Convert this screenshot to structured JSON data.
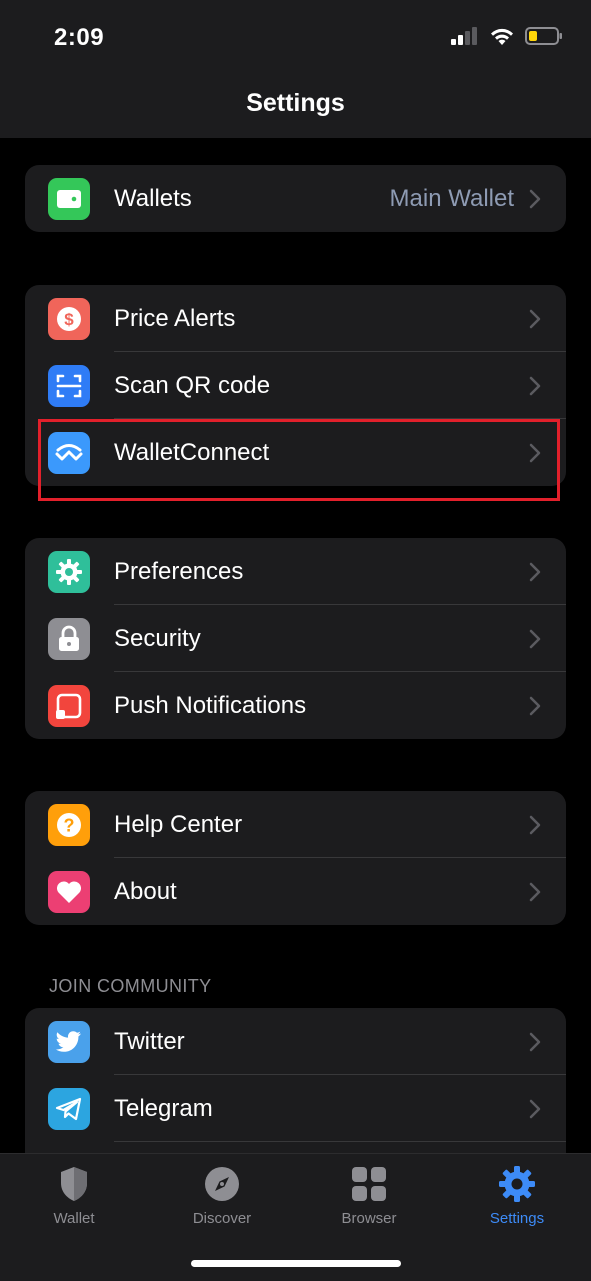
{
  "status_bar": {
    "time": "2:09"
  },
  "header": {
    "title": "Settings"
  },
  "groups": {
    "wallets": {
      "items": [
        {
          "label": "Wallets",
          "value": "Main Wallet",
          "icon": "wallet-icon",
          "color": "#34c759"
        }
      ]
    },
    "tools": {
      "items": [
        {
          "label": "Price Alerts",
          "icon": "dollar-icon",
          "color": "#f0655a"
        },
        {
          "label": "Scan QR code",
          "icon": "scan-qr-icon",
          "color": "#2f7cf6"
        },
        {
          "label": "WalletConnect",
          "icon": "walletconnect-icon",
          "color": "#3b99fc"
        }
      ]
    },
    "settings": {
      "items": [
        {
          "label": "Preferences",
          "icon": "gear-icon",
          "color": "#2fbf9a"
        },
        {
          "label": "Security",
          "icon": "lock-icon",
          "color": "#8e8e93"
        },
        {
          "label": "Push Notifications",
          "icon": "notification-icon",
          "color": "#f2453d"
        }
      ]
    },
    "support": {
      "items": [
        {
          "label": "Help Center",
          "icon": "question-icon",
          "color": "#ff9f0a"
        },
        {
          "label": "About",
          "icon": "heart-icon",
          "color": "#ec3f73"
        }
      ]
    },
    "community": {
      "header": "JOIN COMMUNITY",
      "items": [
        {
          "label": "Twitter",
          "icon": "twitter-icon",
          "color": "#4aa1eb"
        },
        {
          "label": "Telegram",
          "icon": "telegram-icon",
          "color": "#2ca5e0"
        }
      ]
    }
  },
  "tab_bar": {
    "tabs": [
      {
        "label": "Wallet",
        "icon": "shield-icon",
        "active": false
      },
      {
        "label": "Discover",
        "icon": "compass-icon",
        "active": false
      },
      {
        "label": "Browser",
        "icon": "grid-icon",
        "active": false
      },
      {
        "label": "Settings",
        "icon": "gear-icon",
        "active": true
      }
    ],
    "active_color": "#3d8bf7",
    "inactive_color": "#8e8e93"
  },
  "annotation": {
    "highlight_color": "#e2202b"
  }
}
